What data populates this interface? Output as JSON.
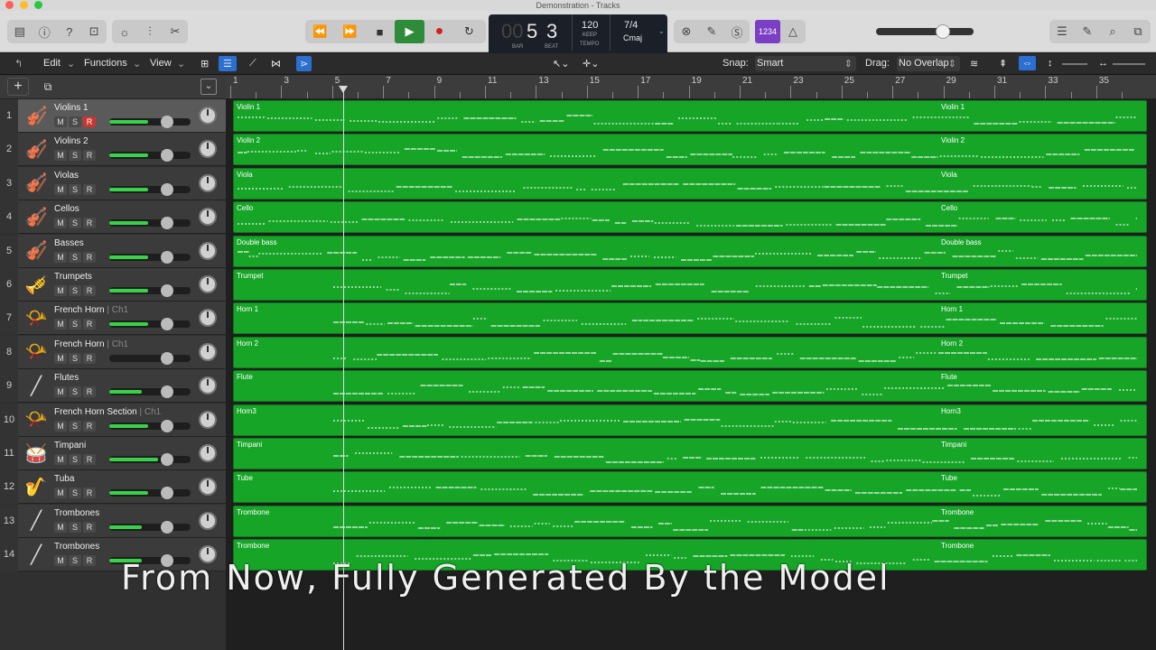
{
  "window": {
    "title": "Demonstration - Tracks"
  },
  "lcd": {
    "bar": "5",
    "beat": "3",
    "bar_label": "BAR",
    "beat_label": "BEAT",
    "tempo": "120",
    "tempo_mode": "KEEP",
    "tempo_label": "TEMPO",
    "signature": "7/4",
    "key": "Cmaj",
    "count_in": "1234"
  },
  "menu": {
    "edit": "Edit",
    "functions": "Functions",
    "view": "View",
    "snap_label": "Snap:",
    "snap_value": "Smart",
    "drag_label": "Drag:",
    "drag_value": "No Overlap"
  },
  "ruler": {
    "bars": [
      "1",
      "3",
      "5",
      "7",
      "9",
      "11",
      "13",
      "15",
      "17",
      "19",
      "21",
      "23",
      "25",
      "27",
      "29",
      "31",
      "33",
      "35"
    ]
  },
  "tracks": [
    {
      "num": "1",
      "name": "Violins 1",
      "ch": "",
      "icon": "violin-icon",
      "glyph": "🎻",
      "region": "Violin 1",
      "volume": 0.72,
      "selected": true,
      "record": true
    },
    {
      "num": "2",
      "name": "Violins 2",
      "ch": "",
      "icon": "violin-icon",
      "glyph": "🎻",
      "region": "Violin 2",
      "volume": 0.72,
      "selected": false,
      "record": false
    },
    {
      "num": "3",
      "name": "Violas",
      "ch": "",
      "icon": "violin-icon",
      "glyph": "🎻",
      "region": "Viola",
      "volume": 0.72,
      "selected": false,
      "record": false
    },
    {
      "num": "4",
      "name": "Cellos",
      "ch": "",
      "icon": "cello-icon",
      "glyph": "🎻",
      "region": "Cello",
      "volume": 0.72,
      "selected": false,
      "record": false
    },
    {
      "num": "5",
      "name": "Basses",
      "ch": "",
      "icon": "violin-icon",
      "glyph": "🎻",
      "region": "Double bass",
      "volume": 0.72,
      "selected": false,
      "record": false
    },
    {
      "num": "6",
      "name": "Trumpets",
      "ch": "",
      "icon": "trumpet-icon",
      "glyph": "🎺",
      "region": "Trumpet",
      "volume": 0.72,
      "selected": false,
      "record": false
    },
    {
      "num": "7",
      "name": "French Horn",
      "ch": "Ch1",
      "icon": "french-horn-icon",
      "glyph": "📯",
      "region": "Horn 1",
      "volume": 0.72,
      "selected": false,
      "record": false
    },
    {
      "num": "8",
      "name": "French Horn",
      "ch": "Ch1",
      "icon": "french-horn-icon",
      "glyph": "📯",
      "region": "Horn 2",
      "volume": 0.0,
      "selected": false,
      "record": false
    },
    {
      "num": "9",
      "name": "Flutes",
      "ch": "",
      "icon": "flute-icon",
      "glyph": "╱",
      "region": "Flute",
      "volume": 0.6,
      "selected": false,
      "record": false
    },
    {
      "num": "10",
      "name": "French Horn Section",
      "ch": "Ch1",
      "icon": "french-horn-icon",
      "glyph": "📯",
      "region": "Horn3",
      "volume": 0.72,
      "selected": false,
      "record": false
    },
    {
      "num": "11",
      "name": "Timpani",
      "ch": "",
      "icon": "timpani-icon",
      "glyph": "🥁",
      "region": "Timpani",
      "volume": 0.9,
      "selected": false,
      "record": false
    },
    {
      "num": "12",
      "name": "Tuba",
      "ch": "",
      "icon": "tuba-icon",
      "glyph": "🎷",
      "region": "Tube",
      "volume": 0.72,
      "selected": false,
      "record": false
    },
    {
      "num": "13",
      "name": "Trombones",
      "ch": "",
      "icon": "trombone-icon",
      "glyph": "╱",
      "region": "Trombone",
      "volume": 0.6,
      "selected": false,
      "record": false
    },
    {
      "num": "14",
      "name": "Trombones",
      "ch": "",
      "icon": "trombone-icon",
      "glyph": "╱",
      "region": "Trombone",
      "volume": 0.6,
      "selected": false,
      "record": false
    }
  ],
  "subtitle": "From Now, Fully Generated By the Model",
  "colors": {
    "region": "#17a528",
    "record": "#c9362f",
    "lcd": "#1a1f28"
  }
}
